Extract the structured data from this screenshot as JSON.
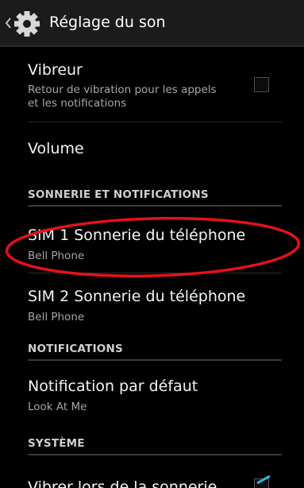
{
  "actionbar": {
    "title": "Réglage du son",
    "back_icon": "chevron-left-icon",
    "app_icon": "gear-icon"
  },
  "items": {
    "vibrate": {
      "title": "Vibreur",
      "summary": "Retour de vibration pour les appels et les notifications",
      "checked": false
    },
    "volume": {
      "title": "Volume"
    },
    "sim1": {
      "title": "SIM 1 Sonnerie du téléphone",
      "summary": "Bell Phone"
    },
    "sim2": {
      "title": "SIM 2 Sonnerie du téléphone",
      "summary": "Bell Phone"
    },
    "default_notification": {
      "title": "Notification par défaut",
      "summary": "Look At Me"
    },
    "partial": {
      "title": "Vibrer lors de la sonnerie",
      "checked": true
    }
  },
  "headers": {
    "ringtone": "SONNERIE ET NOTIFICATIONS",
    "notifications": "NOTIFICATIONS",
    "system": "SYSTÈME"
  },
  "colors": {
    "accent": "#33b5e5",
    "highlight_ring": "#e3121b",
    "background": "#000000"
  }
}
